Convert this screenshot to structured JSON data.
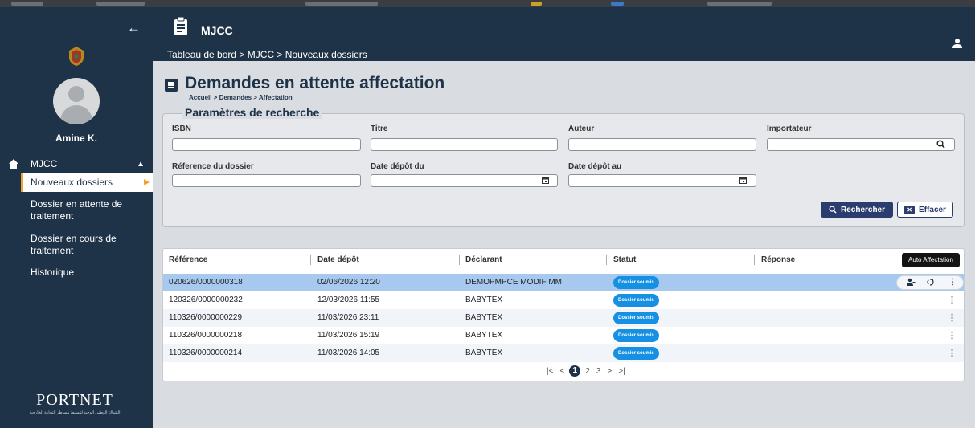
{
  "app": {
    "name": "MJCC",
    "breadcrumb": "Tableau de bord > MJCC > Nouveaux dossiers"
  },
  "sidebar": {
    "user_name": "Amine K.",
    "group_label": "MJCC",
    "items": [
      {
        "label": "Nouveaux dossiers"
      },
      {
        "label": "Dossier en attente de traitement"
      },
      {
        "label": "Dossier en cours de traitement"
      },
      {
        "label": "Historique"
      }
    ],
    "logo_text": "PORTNET",
    "logo_subtext": "الشباك الوطني الوحيد لتبسيط مساطر التجارة الخارجية"
  },
  "page": {
    "title": "Demandes en attente affectation",
    "breadcrumb": "Accueil > Demandes > Affectation"
  },
  "search": {
    "legend": "Paramètres de recherche",
    "isbn_label": "ISBN",
    "titre_label": "Titre",
    "auteur_label": "Auteur",
    "importateur_label": "Importateur",
    "reference_label": "Réference du dossier",
    "date_du_label": "Date dépôt du",
    "date_au_label": "Date dépôt au",
    "search_button": "Rechercher",
    "clear_button": "Effacer"
  },
  "table": {
    "columns": [
      "Référence",
      "Date dépôt",
      "Déclarant",
      "Statut",
      "Réponse"
    ],
    "tooltip": "Auto Affectation",
    "rows": [
      {
        "reference": "020626/0000000318",
        "date": "02/06/2026 12:20",
        "declarant": "DEMOPMPCE MODIF MM",
        "statut": "Dossier soumis"
      },
      {
        "reference": "120326/0000000232",
        "date": "12/03/2026 11:55",
        "declarant": "BABYTEX",
        "statut": "Dossier soumis"
      },
      {
        "reference": "110326/0000000229",
        "date": "11/03/2026 23:11",
        "declarant": "BABYTEX",
        "statut": "Dossier soumis"
      },
      {
        "reference": "110326/0000000218",
        "date": "11/03/2026 15:19",
        "declarant": "BABYTEX",
        "statut": "Dossier soumis"
      },
      {
        "reference": "110326/0000000214",
        "date": "11/03/2026 14:05",
        "declarant": "BABYTEX",
        "statut": "Dossier soumis"
      }
    ]
  },
  "pagination": {
    "first": "|<",
    "prev": "<",
    "pages": [
      "1",
      "2",
      "3"
    ],
    "next": ">",
    "last": ">|"
  },
  "colors": {
    "navy": "#1f3348",
    "accent": "#f2a22c",
    "badge": "#1690e2",
    "selected_row": "#a7c9ef",
    "button": "#2a3d6e"
  }
}
